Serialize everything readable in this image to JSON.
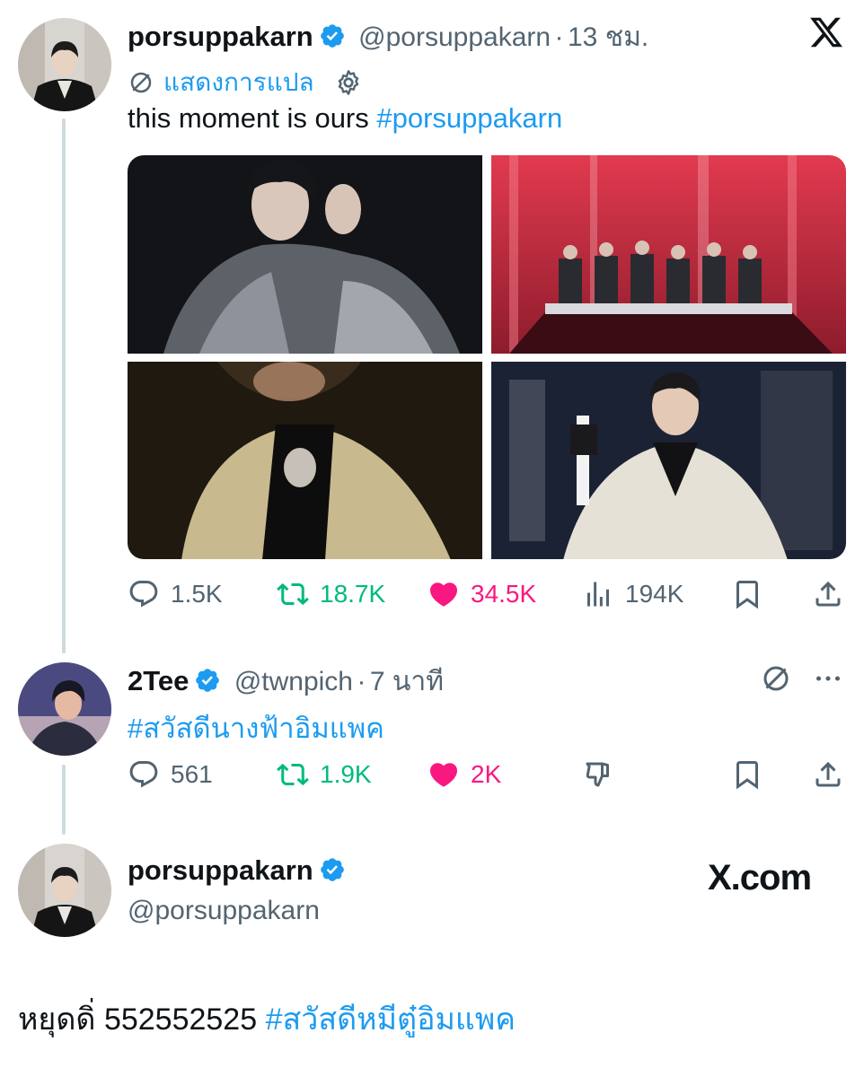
{
  "tweet1": {
    "display_name": "porsuppakarn",
    "handle": "@porsuppakarn",
    "separator": "·",
    "time": "13 ชม.",
    "translate_label": "แสดงการแปล",
    "text_plain": "this moment is ours ",
    "hashtag": "#porsuppakarn",
    "stats": {
      "replies": "1.5K",
      "retweets": "18.7K",
      "likes": "34.5K",
      "views": "194K"
    }
  },
  "tweet2": {
    "display_name": "2Tee",
    "handle": "@twnpich",
    "separator": "·",
    "time": "7 นาที",
    "hashtag": "#สวัสดีนางฟ้าอิมแพค",
    "stats": {
      "replies": "561",
      "retweets": "1.9K",
      "likes": "2K"
    }
  },
  "tweet3": {
    "display_name": "porsuppakarn",
    "handle": "@porsuppakarn",
    "site": "X.com",
    "text_plain": "หยุดดิ่ 552552525 ",
    "hashtag": "#สวัสดีหมีตู๋อิมแพค"
  },
  "colors": {
    "link": "#1d9bf0",
    "retweet": "#00ba7c",
    "like": "#f91880",
    "muted": "#536471",
    "thread_line": "#cfd9de"
  },
  "icons": [
    "x-logo-icon",
    "verified-badge-icon",
    "translate-globe-icon",
    "gear-icon",
    "reply-icon",
    "retweet-icon",
    "heart-icon",
    "views-icon",
    "bookmark-icon",
    "share-icon",
    "more-icon",
    "dislike-icon"
  ]
}
